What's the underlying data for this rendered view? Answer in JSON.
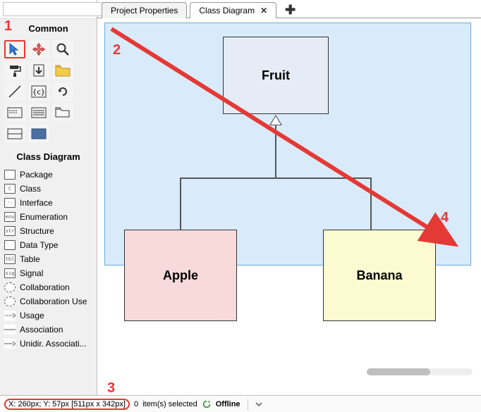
{
  "search": {
    "placeholder": ""
  },
  "sections": {
    "common": "Common",
    "classdiagram": "Class Diagram"
  },
  "tools": {
    "cursor": "cursor-icon",
    "move": "move-icon",
    "zoom": "zoom-icon",
    "fill": "paint-roller-icon",
    "download": "download-arrow-icon",
    "folder": "folder-icon",
    "line": "line-icon",
    "code": "code-braces-icon",
    "rotate": "rotate-icon",
    "dash": "dash-box-icon",
    "lines": "lines-box-icon",
    "open_folder": "folder-open-icon",
    "split": "split-box-icon",
    "solid": "solid-box-icon"
  },
  "palette": [
    {
      "label": "Package",
      "ico": ""
    },
    {
      "label": "Class",
      "ico": "C"
    },
    {
      "label": "Interface",
      "ico": "◦◦"
    },
    {
      "label": "Enumeration",
      "ico": "enu"
    },
    {
      "label": "Structure",
      "ico": "str"
    },
    {
      "label": "Data Type",
      "ico": ""
    },
    {
      "label": "Table",
      "ico": "tbl"
    },
    {
      "label": "Signal",
      "ico": "sig"
    },
    {
      "label": "Collaboration",
      "ico": "⬭"
    },
    {
      "label": "Collaboration Use",
      "ico": "⬭"
    },
    {
      "label": "Usage",
      "ico": ""
    },
    {
      "label": "Association",
      "ico": ""
    },
    {
      "label": "Unidir. Associati...",
      "ico": ""
    }
  ],
  "tabs": {
    "project": "Project Properties",
    "diagram": "Class Diagram",
    "close": "✕",
    "new": "✚"
  },
  "nodes": {
    "fruit": "Fruit",
    "apple": "Apple",
    "banana": "Banana"
  },
  "status": {
    "coords": "X: 260px; Y: 57px  [511px x 342px]",
    "items_suffix": " item(s) selected",
    "items_count": "0",
    "offline": "Offline"
  },
  "annotations": {
    "a1": "1",
    "a2": "2",
    "a3": "3",
    "a4": "4"
  },
  "colors": {
    "accent": "#e53935",
    "selection": "#aad2f5"
  }
}
